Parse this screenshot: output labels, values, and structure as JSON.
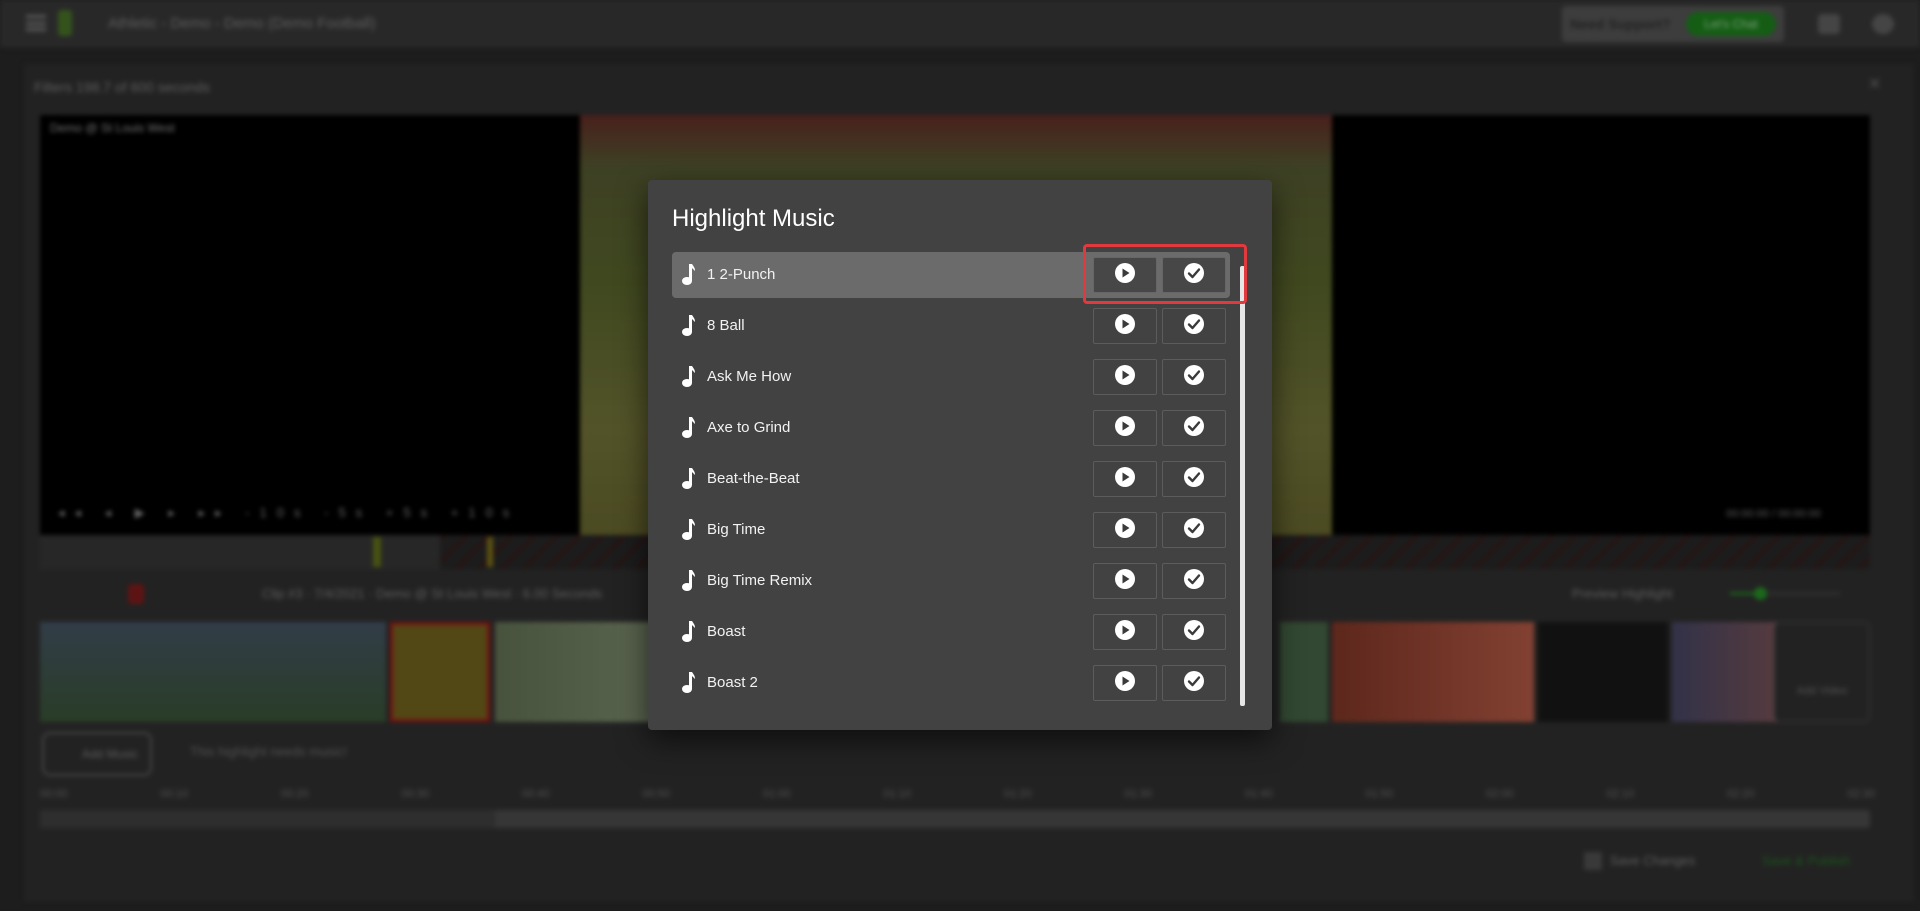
{
  "header": {
    "org_title": "Athletic - Demo - Demo (Demo Football)",
    "support_text": "Need Support?",
    "support_button": "Let's Chat"
  },
  "editor": {
    "panel_title": "Filters 198.7 of 600 seconds",
    "video_label": "Demo @ St Louis West",
    "video_controls": "◂◂ ◂ ▶ ▸ ▸▸ -10s -5s +5s +10s",
    "video_time": "00:00:00 / 00:00:00",
    "clip_info": "Clip #3 · 7/4/2021 · Demo @ St Louis West · 6.00 Seconds",
    "preview_label": "Preview Highlight",
    "add_video_label": "Add Video",
    "add_music_label": "Add Music",
    "no_music_text": "This highlight needs music!",
    "ruler_ticks": [
      "00:00",
      "00:10",
      "00:20",
      "00:30",
      "00:40",
      "00:50",
      "01:00",
      "01:10",
      "01:20",
      "01:30",
      "01:40",
      "01:50",
      "02:00",
      "02:10",
      "02:20",
      "02:30"
    ],
    "save_changes": "Save Changes",
    "save_send": "Save & Publish"
  },
  "modal": {
    "title": "Highlight Music",
    "tracks": [
      {
        "label": "1 2-Punch",
        "selected": true
      },
      {
        "label": "8 Ball",
        "selected": false
      },
      {
        "label": "Ask Me How",
        "selected": false
      },
      {
        "label": "Axe to Grind",
        "selected": false
      },
      {
        "label": "Beat-the-Beat",
        "selected": false
      },
      {
        "label": "Big Time",
        "selected": false
      },
      {
        "label": "Big Time Remix",
        "selected": false
      },
      {
        "label": "Boast",
        "selected": false
      },
      {
        "label": "Boast 2",
        "selected": false
      }
    ],
    "actions": {
      "play_icon": "play-circle-icon",
      "select_icon": "check-circle-icon"
    }
  },
  "colors": {
    "modal_bg": "#424242",
    "selected_row": "#6b6b6b",
    "highlight_border": "#e0393e",
    "brand_green": "#1f8a1f"
  }
}
